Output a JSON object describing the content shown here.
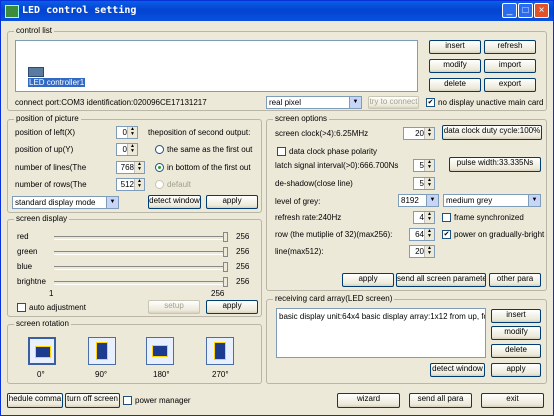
{
  "window": {
    "title": "LED control setting"
  },
  "control_list": {
    "legend": "control list",
    "item_label": "LED controller1",
    "connect_info": "connect port:COM3 identification:020096CE17131217",
    "pixel_mode": "real pixel",
    "try_connect": "try to connect",
    "no_display_label": "no display unactive main card",
    "buttons": {
      "insert": "insert",
      "refresh": "refresh",
      "modify": "modify",
      "import": "import",
      "delete": "delete",
      "export": "export"
    }
  },
  "position": {
    "legend": "position of picture",
    "left_label": "position of left(X)",
    "left_value": "0",
    "up_label": "position of up(Y)",
    "up_value": "0",
    "lines_label": "number  of lines(The",
    "lines_value": "768",
    "rows_label": "number  of rows(The",
    "rows_value": "512",
    "second_output_label": "theposition of second output:",
    "opt_same": "the same as the first out",
    "opt_bottom": "in bottom of the first out",
    "opt_default": "default",
    "display_mode": "standard display mode",
    "detect_window": "detect window",
    "apply": "apply"
  },
  "screen_display": {
    "legend": "screen display",
    "sliders": [
      {
        "label": "red",
        "value": "256",
        "level": 1.0
      },
      {
        "label": "green",
        "value": "256",
        "level": 1.0
      },
      {
        "label": "blue",
        "value": "256",
        "level": 1.0
      },
      {
        "label": "brightne",
        "value": "256",
        "level": 1.0
      }
    ],
    "scale_min": "1",
    "scale_max": "256",
    "auto_adjust": "auto adjustment",
    "setup": "setup",
    "apply": "apply"
  },
  "screen_rotation": {
    "legend": "screen rotation",
    "angles": [
      "0°",
      "90°",
      "180°",
      "270°"
    ]
  },
  "screen_options": {
    "legend": "screen options",
    "clock_label": "screen clock(>4):6.25MHz",
    "clock_value": "20",
    "duty_cycle": "data clock duty cycle:100%",
    "phase_polarity": "data clock phase polarity",
    "latch_label": "latch signal interval(>0):666.700Ns",
    "latch_value": "5",
    "pulse_width": "pulse width:33.335Ns",
    "deshadow_label": "de-shadow(close line)",
    "deshadow_value": "5",
    "grey_label": "level of grey:",
    "grey_value": "8192",
    "grey_mode": "medium grey",
    "refresh_label": "refresh rate:240Hz",
    "refresh_value": "4",
    "frame_sync": "frame synchronized",
    "row_label": "row (the mutiplie of 32)(max256):",
    "row_value": "64",
    "power_on": "power on gradually-bright",
    "line_label": "line(max512):",
    "line_value": "20",
    "apply": "apply",
    "send_all": "send all screen parameters",
    "other_para": "other para"
  },
  "receiving_card": {
    "legend": "receiving card array(LED screen)",
    "item": "basic display unit:64x4 basic display array:1x12 from up, form",
    "insert": "insert",
    "modify": "modify",
    "delete": "delete",
    "detect_window": "detect window",
    "apply": "apply"
  },
  "bottom": {
    "schedule": "hedule comma",
    "turn_off": "turn off screen",
    "power_manager": "power manager",
    "wizard": "wizard",
    "send_all_para": "send all para",
    "exit": "exit"
  },
  "colors": {
    "title_bar": "#0343d0",
    "face": "#ece9d8",
    "accent": "#003c74"
  }
}
